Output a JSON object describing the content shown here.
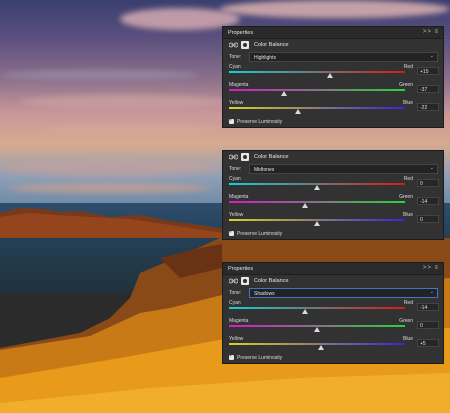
{
  "panels": [
    {
      "header": {
        "title": "Properties",
        "controls": ">> ≡"
      },
      "layer": {
        "label": "Color Balance",
        "icons": [
          "balance-scale-icon",
          "mask-icon"
        ]
      },
      "tone": {
        "label": "Tone:",
        "value": "Highlights",
        "active": false
      },
      "sliders": [
        {
          "left": "Cyan",
          "right": "Red",
          "value": "+15",
          "position": 0.575
        },
        {
          "left": "Magenta",
          "right": "Green",
          "value": "-37",
          "position": 0.315
        },
        {
          "left": "Yellow",
          "right": "Blue",
          "value": "-22",
          "position": 0.39
        }
      ],
      "preserve": {
        "label": "Preserve Luminosity",
        "checked": true
      }
    },
    {
      "header": {
        "title": "",
        "controls": ""
      },
      "layer": {
        "label": "Color Balance",
        "icons": [
          "balance-scale-icon",
          "mask-icon"
        ]
      },
      "tone": {
        "label": "Tone:",
        "value": "Midtones",
        "active": false
      },
      "sliders": [
        {
          "left": "Cyan",
          "right": "Red",
          "value": "0",
          "position": 0.5
        },
        {
          "left": "Magenta",
          "right": "Green",
          "value": "-14",
          "position": 0.43
        },
        {
          "left": "Yellow",
          "right": "Blue",
          "value": "0",
          "position": 0.5
        }
      ],
      "preserve": {
        "label": "Preserve Luminosity",
        "checked": true
      }
    },
    {
      "header": {
        "title": "Properties",
        "controls": ">> ≡"
      },
      "layer": {
        "label": "Color Balance",
        "icons": [
          "balance-scale-icon",
          "mask-icon"
        ]
      },
      "tone": {
        "label": "Tone:",
        "value": "Shadows",
        "active": true
      },
      "sliders": [
        {
          "left": "Cyan",
          "right": "Red",
          "value": "-14",
          "position": 0.43
        },
        {
          "left": "Magenta",
          "right": "Green",
          "value": "0",
          "position": 0.5
        },
        {
          "left": "Yellow",
          "right": "Blue",
          "value": "+5",
          "position": 0.525
        }
      ],
      "preserve": {
        "label": "Preserve Luminosity",
        "checked": true
      }
    }
  ],
  "colors": {
    "panel_bg": "#323232",
    "accent_blue": "#3f76c8"
  }
}
